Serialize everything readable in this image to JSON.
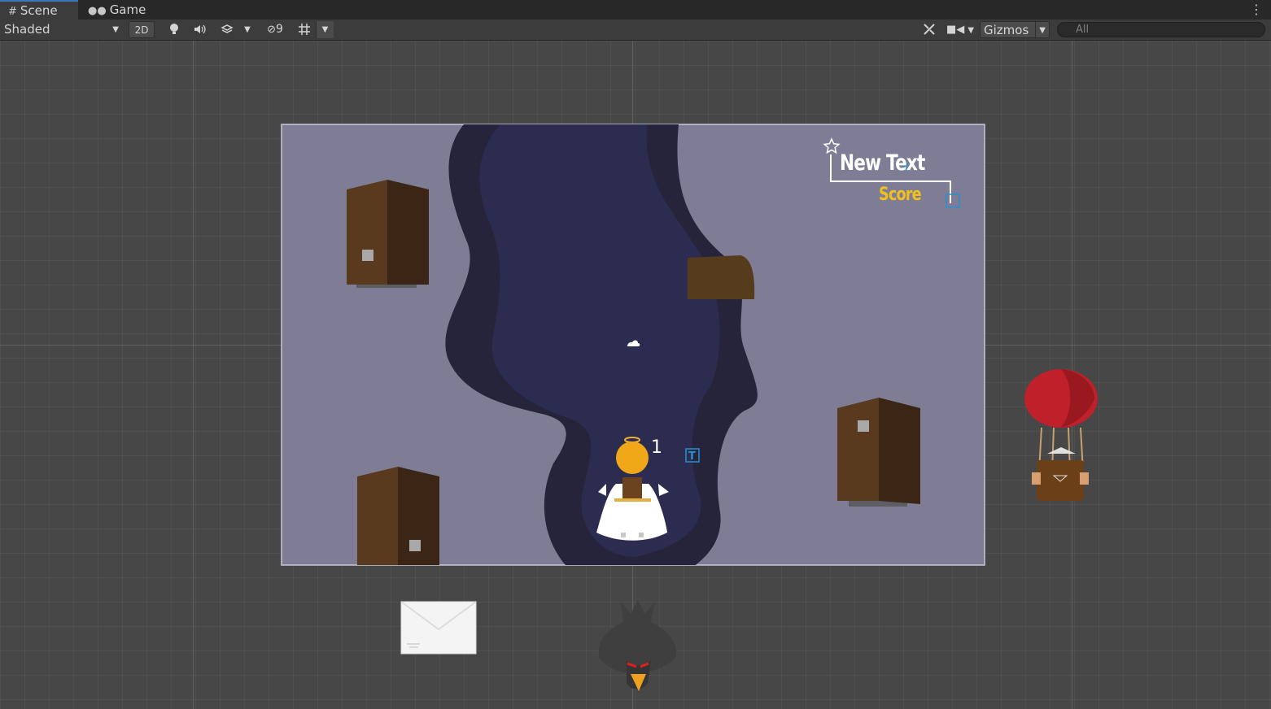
{
  "tabs": {
    "scene": {
      "icon": "grid-icon",
      "label": "Scene"
    },
    "game": {
      "icon": "gamepad-icon",
      "label": "Game"
    }
  },
  "toolbar": {
    "shading_mode": "Shaded",
    "two_d_label": "2D",
    "hidden_count": "9",
    "gizmos_label": "Gizmos",
    "search_placeholder": "All"
  },
  "scene": {
    "new_text": "New Text",
    "score_label": "Score",
    "score_value": "1"
  },
  "colors": {
    "canvas_bg": "#7e7d95",
    "river_outer": "#26243a",
    "river_inner": "#2c2b50",
    "door_light": "#5a3a1e",
    "door_dark": "#3b2616",
    "balloon_red": "#c0202a",
    "score_gold": "#f0c020"
  }
}
